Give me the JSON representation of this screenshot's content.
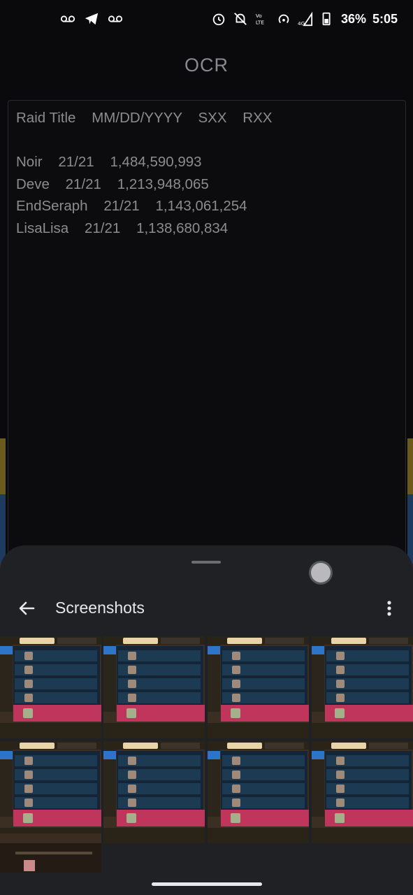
{
  "status_bar": {
    "left_icons": [
      "voicemail-icon",
      "telegram-icon",
      "voicemail-icon"
    ],
    "right_icons": [
      "alarm-icon",
      "bell-off-icon",
      "volte-icon",
      "hotspot-icon",
      "signal-4g-icon",
      "battery-icon"
    ],
    "battery": "36%",
    "time": "5:05"
  },
  "app": {
    "title": "OCR"
  },
  "ocr": {
    "header": "Raid Title    MM/DD/YYYY    SXX    RXX",
    "lines": [
      "Noir    21/21    1,484,590,993",
      "Deve    21/21    1,213,948,065",
      "EndSeraph    21/21    1,143,061,254",
      "LisaLisa    21/21    1,138,680,834"
    ]
  },
  "sheet": {
    "title": "Screenshots",
    "back_icon": "arrow-back-icon",
    "more_icon": "more-vert-icon"
  },
  "colors": {
    "background": "#0a0a0c",
    "sheet": "#202124",
    "accent_blue": "#2e74c9",
    "accent_pink": "#c0355c"
  }
}
